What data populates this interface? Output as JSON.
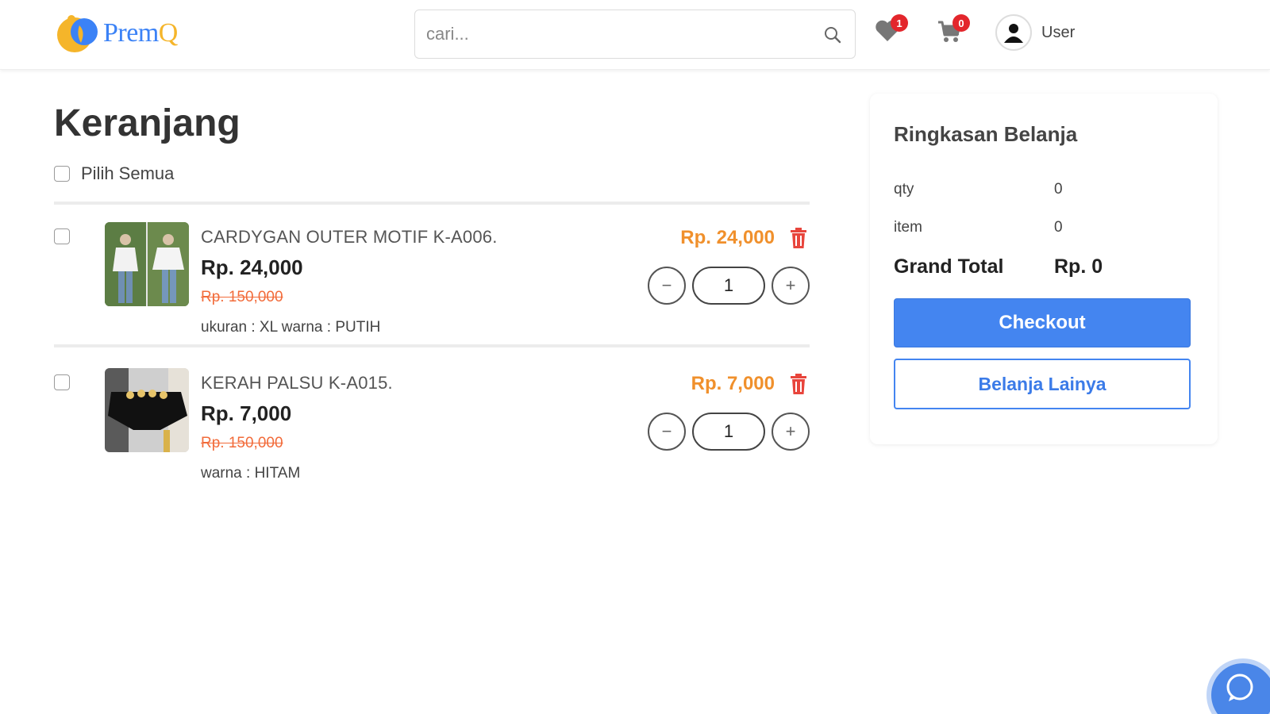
{
  "header": {
    "logo_text_main": "Prem",
    "logo_text_accent": "Q",
    "search_placeholder": "cari...",
    "wishlist_count": "1",
    "cart_count": "0",
    "user_name": "User"
  },
  "page": {
    "title": "Keranjang",
    "select_all_label": "Pilih Semua"
  },
  "cart": {
    "items": [
      {
        "name": "CARDYGAN OUTER MOTIF K-A006.",
        "price": "Rp. 24,000",
        "old_price": "Rp. 150,000",
        "variant": "ukuran : XL warna : PUTIH",
        "subtotal": "Rp. 24,000",
        "quantity": "1"
      },
      {
        "name": "KERAH PALSU K-A015.",
        "price": "Rp. 7,000",
        "old_price": "Rp. 150,000",
        "variant": "warna : HITAM",
        "subtotal": "Rp. 7,000",
        "quantity": "1"
      }
    ]
  },
  "summary": {
    "title": "Ringkasan Belanja",
    "qty_label": "qty",
    "qty_value": "0",
    "item_label": "item",
    "item_value": "0",
    "grand_total_label": "Grand Total",
    "grand_total_value": "Rp. 0",
    "checkout_label": "Checkout",
    "continue_label": "Belanja Lainya"
  },
  "colors": {
    "primary": "#4485f0",
    "price_accent": "#f0902c",
    "old_price": "#f26b3a",
    "badge": "#e3262c",
    "trash": "#e8453c"
  },
  "icons": [
    "search-icon",
    "heart-icon",
    "cart-icon",
    "user-icon",
    "trash-icon",
    "minus-icon",
    "plus-icon",
    "chat-icon"
  ]
}
